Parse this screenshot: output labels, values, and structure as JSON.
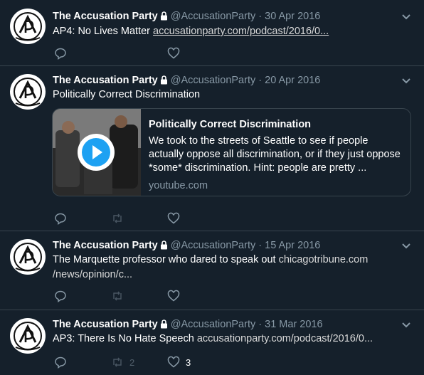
{
  "tweets": [
    {
      "name": "The Accusation Party",
      "handle": "@AccusationParty",
      "sep": "·",
      "date": "30 Apr 2016",
      "text": "AP4: No Lives Matter",
      "link": "accusationparty.com/podcast/2016/0..."
    },
    {
      "name": "The Accusation Party",
      "handle": "@AccusationParty",
      "sep": "·",
      "date": "20 Apr 2016",
      "text": "Politically Correct Discrimination",
      "card": {
        "title": "Politically Correct Discrimination",
        "description": "We took to the streets of Seattle to see if people actually oppose all discrimination, or if they just oppose *some* discrimination. Hint: people are pretty ...",
        "domain": "youtube.com"
      }
    },
    {
      "name": "The Accusation Party",
      "handle": "@AccusationParty",
      "sep": "·",
      "date": "15 Apr 2016",
      "text": "The Marquette professor who dared to speak out",
      "link": "chicagotribune.com",
      "link2": "/news/opinion/c..."
    },
    {
      "name": "The Accusation Party",
      "handle": "@AccusationParty",
      "sep": "·",
      "date": "31 Mar 2016",
      "text": "AP3: There Is No Hate Speech",
      "link": "accusationparty.com/podcast/2016/0...",
      "retweet_count": "2",
      "like_count": "3"
    }
  ],
  "colors": {
    "background": "#15202b",
    "border": "#38444d",
    "secondary_text": "#8899a6",
    "play_button": "#1da1f2"
  },
  "icons": [
    "lock-icon",
    "chevron-down-icon",
    "reply-icon",
    "retweet-icon",
    "like-icon",
    "play-icon",
    "avatar-logo"
  ]
}
